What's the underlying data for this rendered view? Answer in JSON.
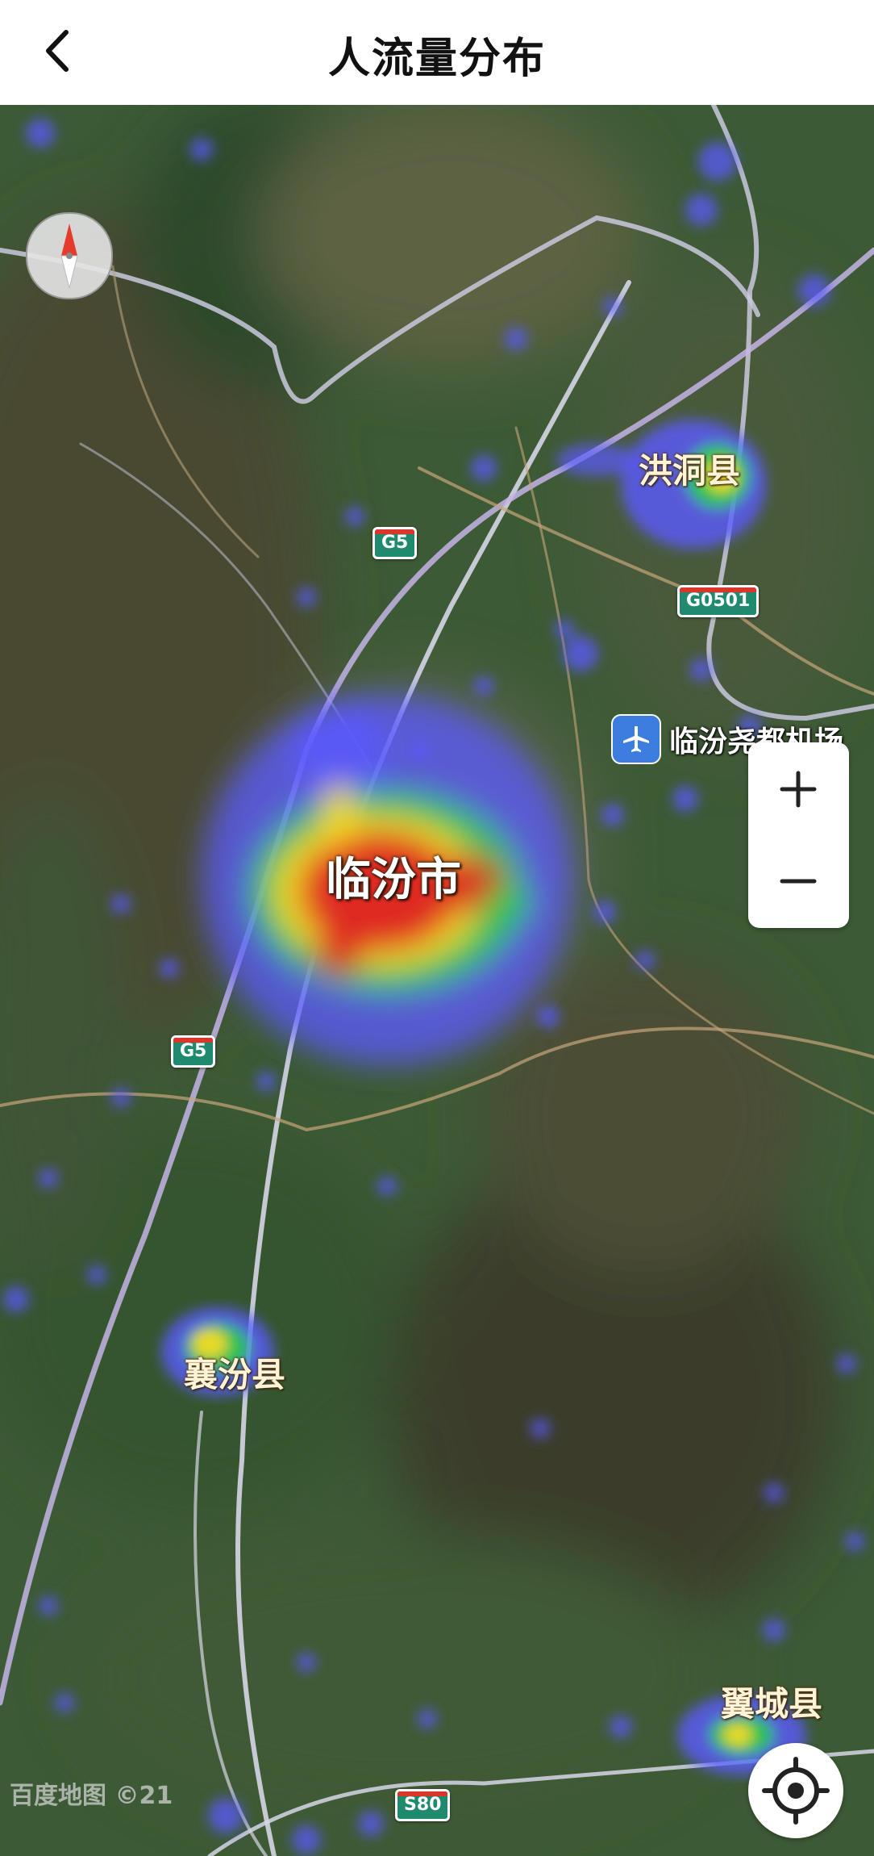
{
  "header": {
    "title": "人流量分布",
    "back_icon": "chevron-left-icon"
  },
  "map": {
    "type": "satellite-heatmap",
    "places": {
      "linfen_city": "临汾市",
      "hongtong": "洪洞县",
      "xiangfen": "襄汾县",
      "yicheng": "翼城县"
    },
    "airport": {
      "label": "临汾尧都机场",
      "icon": "airplane-icon"
    },
    "highway_shields": [
      "G5",
      "G0501",
      "G5",
      "S80"
    ],
    "watermark": "百度地图 ©21",
    "heat_colors": {
      "low": "#5a5aff",
      "mid": "#22cc44",
      "high": "#ffdd22",
      "peak": "#dd2222"
    }
  },
  "controls": {
    "zoom_in_label": "+",
    "zoom_out_label": "−",
    "compass_icon": "compass-icon",
    "locate_icon": "locate-icon"
  }
}
